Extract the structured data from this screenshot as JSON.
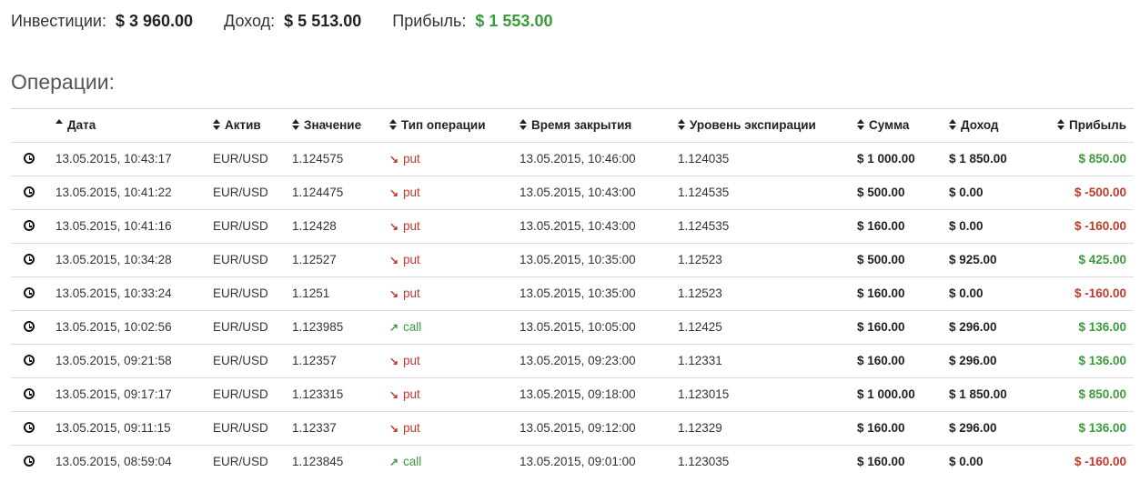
{
  "summary": {
    "investments_label": "Инвестиции:",
    "investments_value": "$ 3 960.00",
    "income_label": "Доход:",
    "income_value": "$ 5 513.00",
    "profit_label": "Прибыль:",
    "profit_value": "$ 1 553.00"
  },
  "section_title": "Операции:",
  "columns": {
    "date": "Дата",
    "asset": "Актив",
    "value": "Значение",
    "type": "Тип операции",
    "close_time": "Время закрытия",
    "expiry_level": "Уровень экспирации",
    "sum": "Сумма",
    "income": "Доход",
    "profit": "Прибыль"
  },
  "colors": {
    "positive": "#3c9a3c",
    "negative": "#c0392b"
  },
  "rows": [
    {
      "date": "13.05.2015, 10:43:17",
      "asset": "EUR/USD",
      "value": "1.124575",
      "type": "put",
      "close_time": "13.05.2015, 10:46:00",
      "expiry_level": "1.124035",
      "sum": "$ 1 000.00",
      "income": "$ 1 850.00",
      "profit": "$ 850.00"
    },
    {
      "date": "13.05.2015, 10:41:22",
      "asset": "EUR/USD",
      "value": "1.124475",
      "type": "put",
      "close_time": "13.05.2015, 10:43:00",
      "expiry_level": "1.124535",
      "sum": "$ 500.00",
      "income": "$ 0.00",
      "profit": "$ -500.00"
    },
    {
      "date": "13.05.2015, 10:41:16",
      "asset": "EUR/USD",
      "value": "1.12428",
      "type": "put",
      "close_time": "13.05.2015, 10:43:00",
      "expiry_level": "1.124535",
      "sum": "$ 160.00",
      "income": "$ 0.00",
      "profit": "$ -160.00"
    },
    {
      "date": "13.05.2015, 10:34:28",
      "asset": "EUR/USD",
      "value": "1.12527",
      "type": "put",
      "close_time": "13.05.2015, 10:35:00",
      "expiry_level": "1.12523",
      "sum": "$ 500.00",
      "income": "$ 925.00",
      "profit": "$ 425.00"
    },
    {
      "date": "13.05.2015, 10:33:24",
      "asset": "EUR/USD",
      "value": "1.1251",
      "type": "put",
      "close_time": "13.05.2015, 10:35:00",
      "expiry_level": "1.12523",
      "sum": "$ 160.00",
      "income": "$ 0.00",
      "profit": "$ -160.00"
    },
    {
      "date": "13.05.2015, 10:02:56",
      "asset": "EUR/USD",
      "value": "1.123985",
      "type": "call",
      "close_time": "13.05.2015, 10:05:00",
      "expiry_level": "1.12425",
      "sum": "$ 160.00",
      "income": "$ 296.00",
      "profit": "$ 136.00"
    },
    {
      "date": "13.05.2015, 09:21:58",
      "asset": "EUR/USD",
      "value": "1.12357",
      "type": "put",
      "close_time": "13.05.2015, 09:23:00",
      "expiry_level": "1.12331",
      "sum": "$ 160.00",
      "income": "$ 296.00",
      "profit": "$ 136.00"
    },
    {
      "date": "13.05.2015, 09:17:17",
      "asset": "EUR/USD",
      "value": "1.123315",
      "type": "put",
      "close_time": "13.05.2015, 09:18:00",
      "expiry_level": "1.123015",
      "sum": "$ 1 000.00",
      "income": "$ 1 850.00",
      "profit": "$ 850.00"
    },
    {
      "date": "13.05.2015, 09:11:15",
      "asset": "EUR/USD",
      "value": "1.12337",
      "type": "put",
      "close_time": "13.05.2015, 09:12:00",
      "expiry_level": "1.12329",
      "sum": "$ 160.00",
      "income": "$ 296.00",
      "profit": "$ 136.00"
    },
    {
      "date": "13.05.2015, 08:59:04",
      "asset": "EUR/USD",
      "value": "1.123845",
      "type": "call",
      "close_time": "13.05.2015, 09:01:00",
      "expiry_level": "1.123035",
      "sum": "$ 160.00",
      "income": "$ 0.00",
      "profit": "$ -160.00"
    }
  ]
}
